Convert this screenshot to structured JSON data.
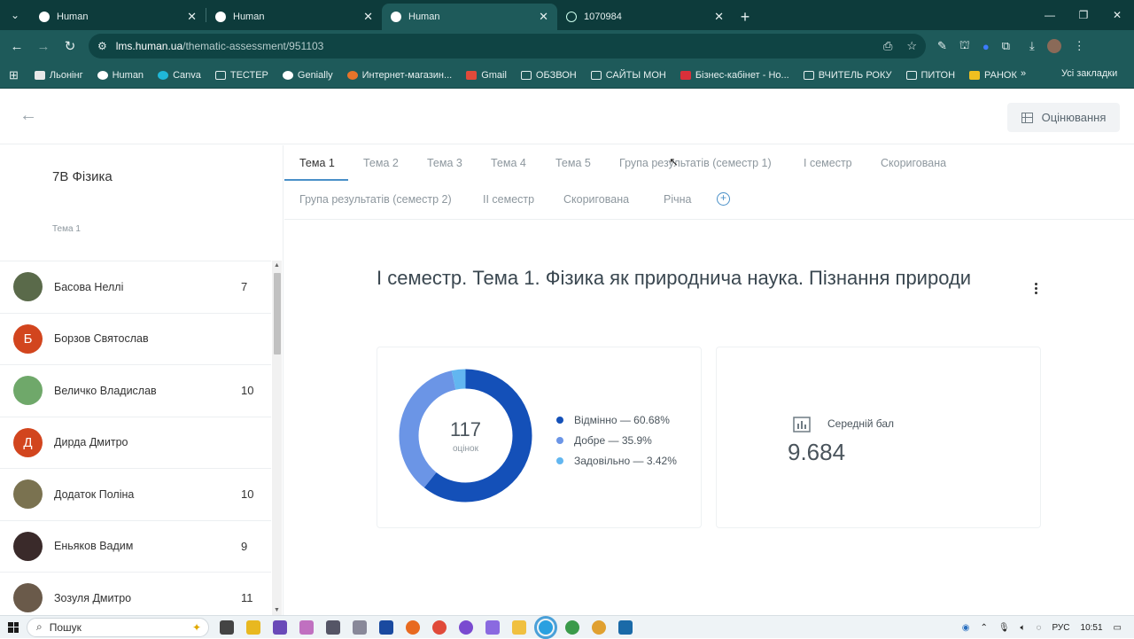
{
  "browser": {
    "tabs": [
      {
        "title": "Human",
        "active": false
      },
      {
        "title": "Human",
        "active": false
      },
      {
        "title": "Human",
        "active": true
      },
      {
        "title": "1070984",
        "active": false
      }
    ],
    "url_host": "lms.human.ua",
    "url_path": "/thematic-assessment/951103",
    "bookmarks": [
      "Льонінг",
      "Human",
      "Canva",
      "ТЕСТЕР",
      "Genially",
      "Интернет-магазин...",
      "Gmail",
      "ОБЗВОН",
      "САЙТЫ МОН",
      "Бізнес-кабінет - Но...",
      "ВЧИТЕЛЬ РОКУ",
      "ПИТОН",
      "РАНОК"
    ],
    "bookmarks_more": "»",
    "all_bookmarks": "Усі закладки"
  },
  "header": {
    "grading_label": "Оцінювання"
  },
  "sidebar": {
    "class_title": "7В Фізика",
    "subtitle": "Тема 1",
    "students": [
      {
        "name": "Басова Неллі",
        "grade": "7",
        "avatar_color": "#5a6a4a",
        "initial": ""
      },
      {
        "name": "Борзов Святослав",
        "grade": "",
        "avatar_color": "#d2451e",
        "initial": "Б"
      },
      {
        "name": "Величко Владислав",
        "grade": "10",
        "avatar_color": "#6fa86a",
        "initial": ""
      },
      {
        "name": "Дирда Дмитро",
        "grade": "",
        "avatar_color": "#d2451e",
        "initial": "Д"
      },
      {
        "name": "Додаток Поліна",
        "grade": "10",
        "avatar_color": "#7a7250",
        "initial": ""
      },
      {
        "name": "Еньяков Вадим",
        "grade": "9",
        "avatar_color": "#3a2a2a",
        "initial": ""
      },
      {
        "name": "Зозуля Дмитро",
        "grade": "11",
        "avatar_color": "#6a5a4a",
        "initial": ""
      }
    ]
  },
  "topic_tabs": {
    "row1": [
      "Тема 1",
      "Тема 2",
      "Тема 3",
      "Тема 4",
      "Тема 5",
      "Група результатів (семестр 1)",
      "І семестр",
      "Скоригована"
    ],
    "row2": [
      "Група результатів (семестр 2)",
      "ІІ семестр",
      "Скоригована",
      "Річна"
    ],
    "active": "Тема 1"
  },
  "assessment": {
    "title": "І семестр. Тема 1. Фізика як природнича наука. Пізнання природи",
    "total_count": "117",
    "total_label": "оцінок",
    "avg_label": "Середній бал",
    "avg_value": "9.684"
  },
  "chart_data": {
    "type": "pie",
    "categories": [
      "Відмінно",
      "Добре",
      "Задовільно"
    ],
    "values": [
      60.68,
      35.9,
      3.42
    ],
    "legend": [
      "Відмінно — 60.68%",
      "Добре — 35.9%",
      "Задовільно — 3.42%"
    ],
    "colors": [
      "#1450b8",
      "#6b95e6",
      "#62b6f0"
    ]
  },
  "taskbar": {
    "search_placeholder": "Пошук",
    "language": "РУС",
    "time": "10:51"
  }
}
